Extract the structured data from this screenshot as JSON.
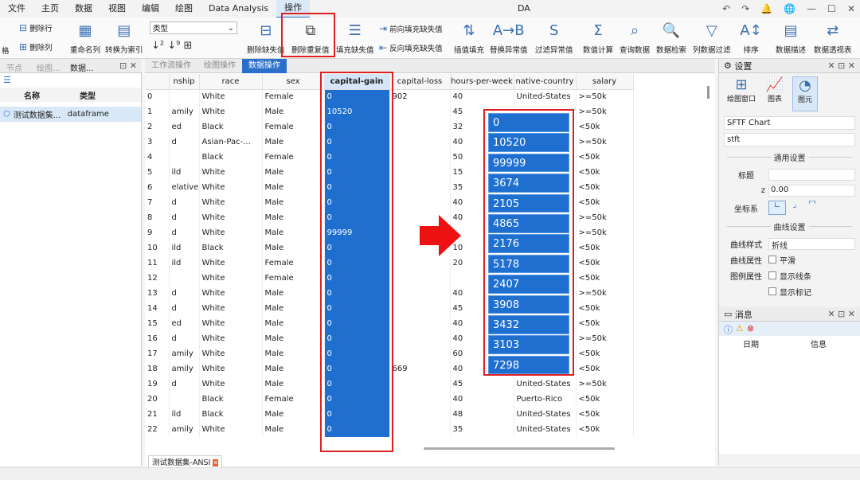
{
  "menu": [
    "文件",
    "主页",
    "数据",
    "视图",
    "编辑",
    "绘图",
    "Data Analysis",
    "操作"
  ],
  "app_title": "DA",
  "ribbon": {
    "small_left": [
      "删除行",
      "删除列",
      "格"
    ],
    "buttons": [
      "重命名列",
      "转换为索引",
      "删除缺失值",
      "删除重复值",
      "填充缺失值",
      "插值填充",
      "替换异常值",
      "过滤异常值",
      "数值计算",
      "查询数据",
      "数据检索",
      "列数据过滤",
      "排序",
      "数据描述",
      "数据透视表"
    ],
    "type_label": "类型",
    "fill_options": [
      "前向填充缺失值",
      "反向填充缺失值"
    ]
  },
  "panel_tabs": {
    "left": [
      "节点",
      "绘图...",
      "数据..."
    ],
    "center": [
      "工作流操作",
      "绘图操作",
      "数据操作"
    ]
  },
  "left_panel": {
    "headers": [
      "名称",
      "类型"
    ],
    "items": [
      {
        "name": "测试数据集...",
        "type": "dataframe"
      }
    ]
  },
  "table": {
    "columns": [
      "nship",
      "race",
      "sex",
      "capital-gain",
      "capital-loss",
      "hours-per-week",
      "native-country",
      "salary"
    ],
    "rows": [
      [
        "0",
        "",
        "White",
        "Female",
        "0",
        "902",
        "40",
        "United-States",
        ">=50k"
      ],
      [
        "1",
        "amily",
        "White",
        "Male",
        "10520",
        "",
        "45",
        "",
        ">=50k"
      ],
      [
        "2",
        "ed",
        "Black",
        "Female",
        "0",
        "",
        "32",
        "",
        "<50k"
      ],
      [
        "3",
        "d",
        "Asian-Pac-...",
        "Male",
        "0",
        "",
        "40",
        "",
        ">=50k"
      ],
      [
        "4",
        "",
        "Black",
        "Female",
        "0",
        "",
        "50",
        "",
        "<50k"
      ],
      [
        "5",
        "ild",
        "White",
        "Male",
        "0",
        "",
        "15",
        "",
        "<50k"
      ],
      [
        "6",
        "elative",
        "White",
        "Male",
        "0",
        "",
        "35",
        "",
        "<50k"
      ],
      [
        "7",
        "d",
        "White",
        "Male",
        "0",
        "",
        "40",
        "",
        "<50k"
      ],
      [
        "8",
        "d",
        "White",
        "Male",
        "0",
        "",
        "40",
        "",
        ">=50k"
      ],
      [
        "9",
        "d",
        "White",
        "Male",
        "99999",
        "",
        "",
        "",
        ">=50k"
      ],
      [
        "10",
        "ild",
        "Black",
        "Male",
        "0",
        "",
        "10",
        "",
        "<50k"
      ],
      [
        "11",
        "ild",
        "White",
        "Female",
        "0",
        "",
        "20",
        "",
        "<50k"
      ],
      [
        "12",
        "",
        "White",
        "Female",
        "0",
        "",
        "",
        "",
        "<50k"
      ],
      [
        "13",
        "d",
        "White",
        "Male",
        "0",
        "",
        "40",
        "",
        ">=50k"
      ],
      [
        "14",
        "d",
        "White",
        "Male",
        "0",
        "",
        "45",
        "",
        "<50k"
      ],
      [
        "15",
        "ed",
        "White",
        "Male",
        "0",
        "",
        "40",
        "",
        "<50k"
      ],
      [
        "16",
        "d",
        "White",
        "Male",
        "0",
        "",
        "40",
        "",
        ">=50k"
      ],
      [
        "17",
        "amily",
        "White",
        "Male",
        "0",
        "",
        "60",
        "",
        "<50k"
      ],
      [
        "18",
        "amily",
        "White",
        "Male",
        "0",
        "669",
        "40",
        "",
        "<50k"
      ],
      [
        "19",
        "d",
        "White",
        "Male",
        "0",
        "",
        "45",
        "United-States",
        ">=50k"
      ],
      [
        "20",
        "",
        "Black",
        "Female",
        "0",
        "",
        "40",
        "Puerto-Rico",
        "<50k"
      ],
      [
        "21",
        "ild",
        "Black",
        "Male",
        "0",
        "",
        "48",
        "United-States",
        "<50k"
      ],
      [
        "22",
        "amily",
        "White",
        "Male",
        "0",
        "",
        "35",
        "United-States",
        "<50k"
      ]
    ]
  },
  "popup_values": [
    "0",
    "10520",
    "99999",
    "3674",
    "2105",
    "4865",
    "2176",
    "5178",
    "2407",
    "3908",
    "3432",
    "3103",
    "7298"
  ],
  "bottom_tab": "测试数据集-ANSI",
  "right_panel": {
    "title": "设置",
    "tabs": [
      "绘图窗口",
      "图表",
      "图元"
    ],
    "chart_name": "SFTF Chart",
    "chart_type": "stft",
    "general_section": "通用设置",
    "title_label": "标题",
    "z_label": "z",
    "z_value": "0.00",
    "axis_label": "坐标系",
    "curve_section": "曲线设置",
    "curve_style_label": "曲线样式",
    "curve_style_value": "折线",
    "curve_attr_label": "曲线属性",
    "smooth_label": "平滑",
    "legend_attr_label": "图例属性",
    "show_line_label": "显示线条",
    "show_marker_label": "显示标记",
    "msg_title": "消息",
    "msg_headers": [
      "日期",
      "信息"
    ]
  }
}
